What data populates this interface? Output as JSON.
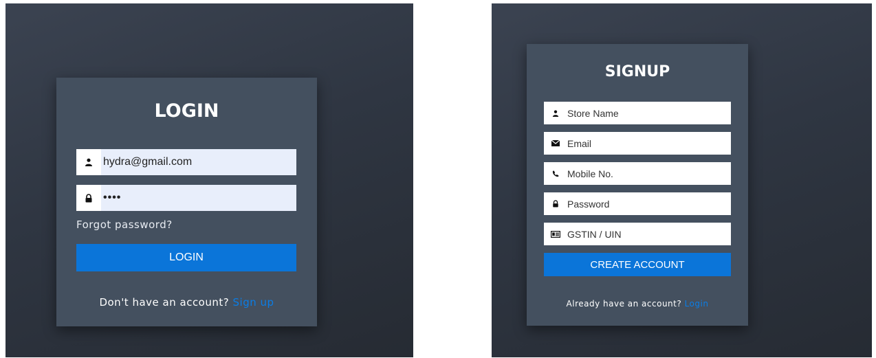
{
  "login": {
    "title": "LOGIN",
    "email_value": "hydra@gmail.com",
    "password_value": "••••",
    "forgot_label": "Forgot password?",
    "button_label": "LOGIN",
    "footer_text": "Don't have an account?",
    "footer_link": "Sign up"
  },
  "signup": {
    "title": "SIGNUP",
    "fields": [
      {
        "label": "Store Name",
        "icon": "user-icon"
      },
      {
        "label": "Email",
        "icon": "envelope-icon"
      },
      {
        "label": "Mobile No.",
        "icon": "phone-icon"
      },
      {
        "label": "Password",
        "icon": "lock-icon"
      },
      {
        "label": "GSTIN / UIN",
        "icon": "id-card-icon"
      }
    ],
    "button_label": "CREATE ACCOUNT",
    "footer_text": "Already have an account?",
    "footer_link": "Login"
  },
  "colors": {
    "accent": "#0b75d9",
    "card": "#44505f",
    "background": "#2f3642"
  }
}
